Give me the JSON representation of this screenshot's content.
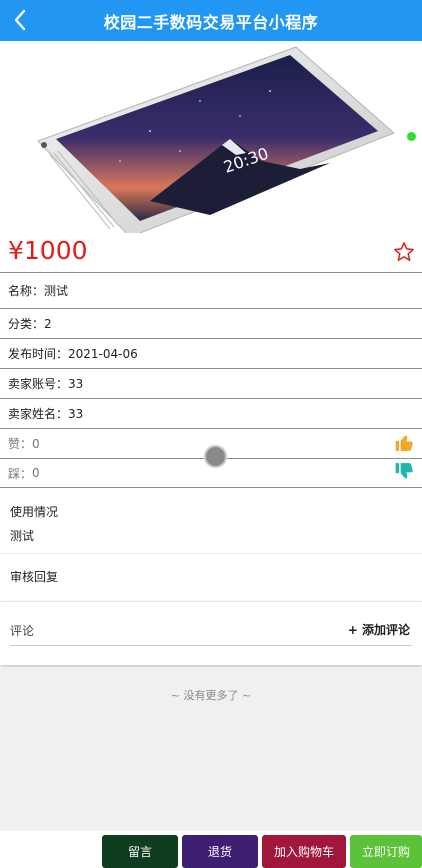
{
  "header": {
    "title": "校园二手数码交易平台小程序"
  },
  "product": {
    "price": "¥1000",
    "name_label": "名称：",
    "name_value": "测试",
    "category_label": "分类：",
    "category_value": "2",
    "publish_time_label": "发布时间：",
    "publish_time_value": "2021-04-06",
    "seller_account_label": "卖家账号：",
    "seller_account_value": "33",
    "seller_name_label": "卖家姓名：",
    "seller_name_value": "33",
    "like_label": "赞：",
    "like_count": "0",
    "dislike_label": "踩：",
    "dislike_count": "0"
  },
  "usage": {
    "title": "使用情况",
    "content": "测试"
  },
  "review": {
    "title": "审核回复"
  },
  "comments": {
    "title": "评论",
    "add_label": "+ 添加评论",
    "empty_text": "~ 没有更多了 ~"
  },
  "actions": {
    "message": "留言",
    "return": "退货",
    "add_to_cart": "加入购物车",
    "buy_now": "立即订购"
  },
  "colors": {
    "header": "#2196f3",
    "price": "#e21b1b",
    "like_icon": "#f5a623",
    "dislike_icon": "#1fb8a8",
    "btn_message": "#0f3d1f",
    "btn_return": "#3d1f73",
    "btn_cart": "#a3163b",
    "btn_buy": "#5cc23a"
  },
  "icons": {
    "back": "chevron-left-icon",
    "favorite": "star-outline-icon",
    "like": "thumbs-up-icon",
    "dislike": "thumbs-down-icon",
    "carousel_indicator": "dot-icon"
  }
}
